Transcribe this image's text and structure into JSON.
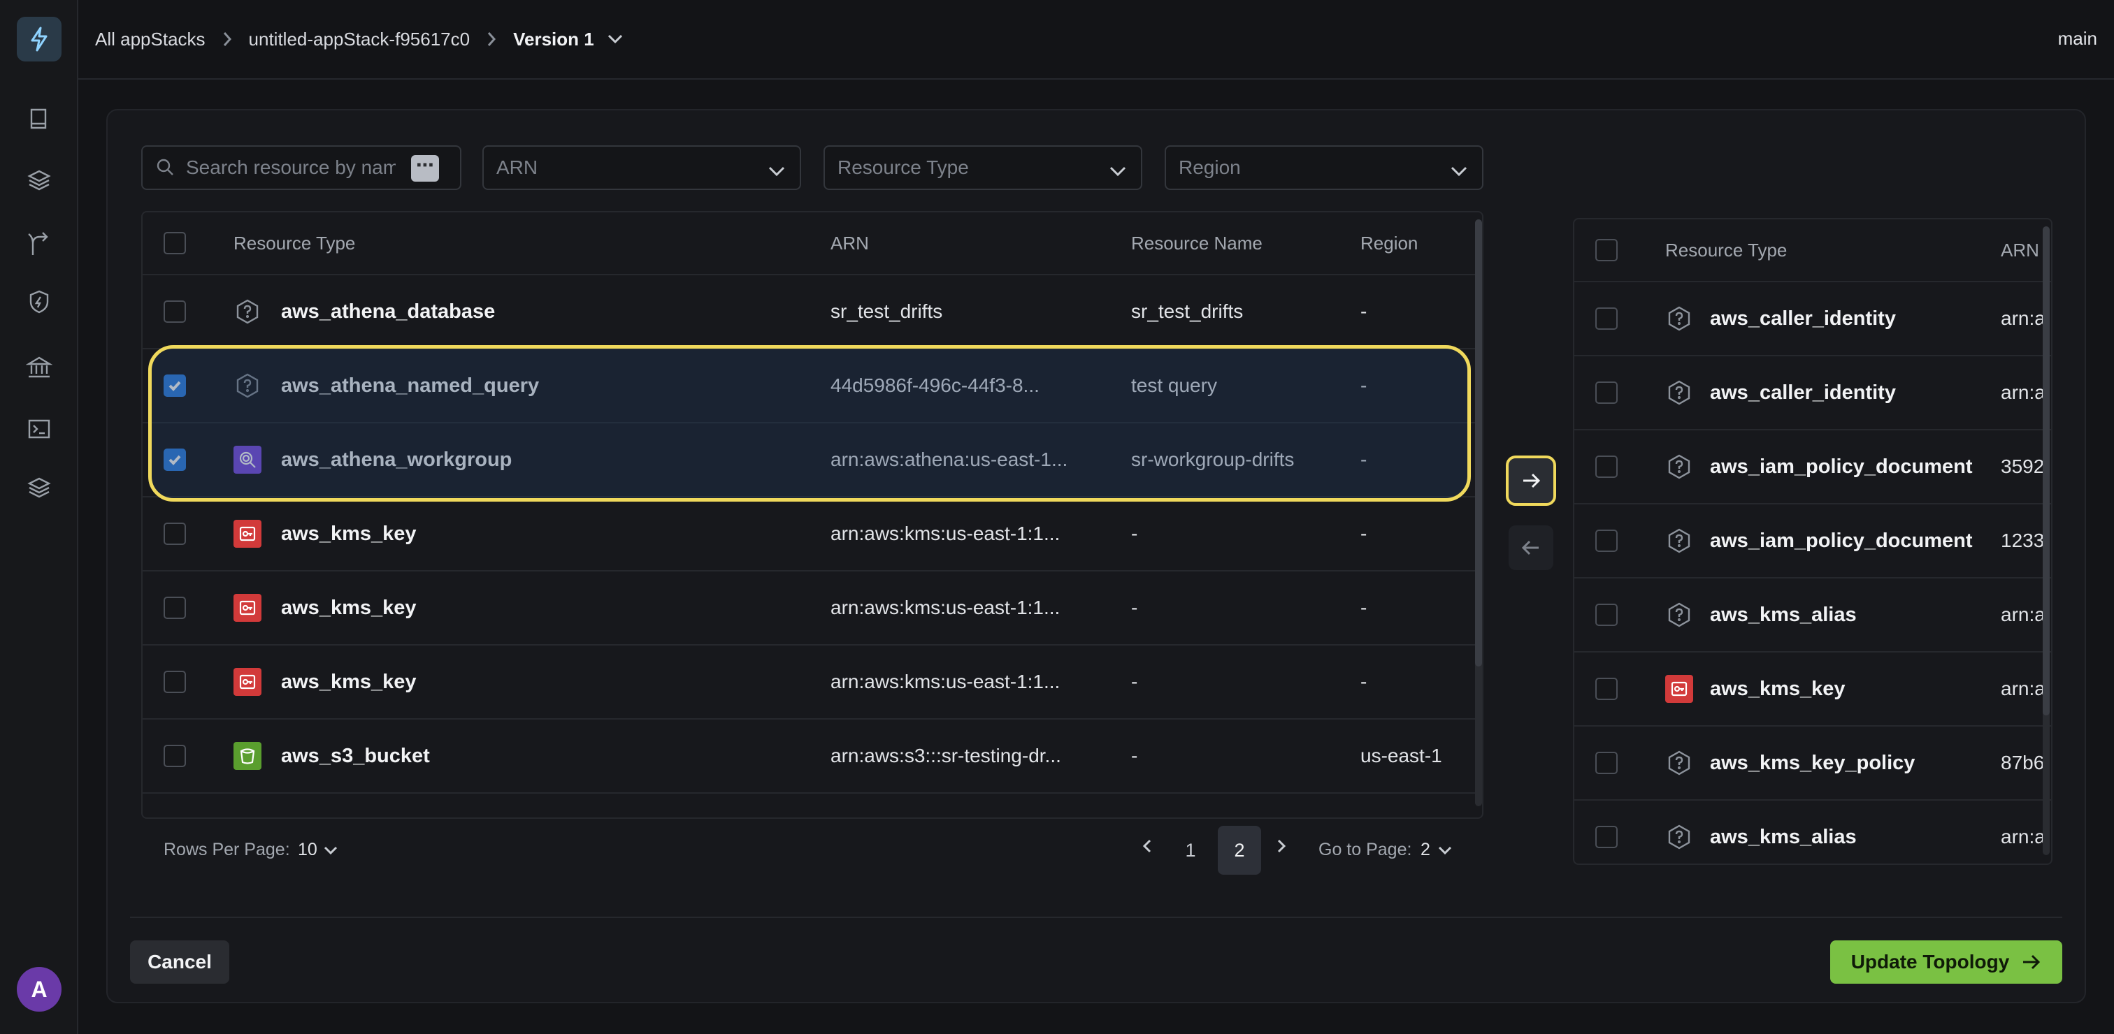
{
  "breadcrumb": {
    "root": "All appStacks",
    "stack": "untitled-appStack-f95617c0",
    "version": "Version 1"
  },
  "branch": "main",
  "avatar_letter": "A",
  "filters": {
    "search_placeholder": "Search resource by name",
    "arn": "ARN",
    "resource_type": "Resource Type",
    "region": "Region"
  },
  "left_table": {
    "headers": {
      "type": "Resource Type",
      "arn": "ARN",
      "name": "Resource Name",
      "region": "Region"
    },
    "rows": [
      {
        "type": "aws_athena_database",
        "arn": "sr_test_drifts",
        "name": "sr_test_drifts",
        "region": "-",
        "icon": "generic-resource-icon",
        "checked": false
      },
      {
        "type": "aws_athena_named_query",
        "arn": "44d5986f-496c-44f3-8...",
        "name": "test query",
        "region": "-",
        "icon": "generic-resource-icon",
        "checked": true
      },
      {
        "type": "aws_athena_workgroup",
        "arn": "arn:aws:athena:us-east-1...",
        "name": "sr-workgroup-drifts",
        "region": "-",
        "icon": "athena-icon",
        "checked": true
      },
      {
        "type": "aws_kms_key",
        "arn": "arn:aws:kms:us-east-1:1...",
        "name": "-",
        "region": "-",
        "icon": "kms-icon",
        "checked": false
      },
      {
        "type": "aws_kms_key",
        "arn": "arn:aws:kms:us-east-1:1...",
        "name": "-",
        "region": "-",
        "icon": "kms-icon",
        "checked": false
      },
      {
        "type": "aws_kms_key",
        "arn": "arn:aws:kms:us-east-1:1...",
        "name": "-",
        "region": "-",
        "icon": "kms-icon",
        "checked": false
      },
      {
        "type": "aws_s3_bucket",
        "arn": "arn:aws:s3:::sr-testing-dr...",
        "name": "-",
        "region": "us-east-1",
        "icon": "s3-icon",
        "checked": false
      }
    ]
  },
  "pagination": {
    "rows_per_page_label": "Rows Per Page:",
    "rows_per_page": "10",
    "pages": [
      "1",
      "2"
    ],
    "current_page": "2",
    "go_to_label": "Go to Page:",
    "go_to_value": "2"
  },
  "right_table": {
    "headers": {
      "type": "Resource Type",
      "arn": "ARN"
    },
    "rows": [
      {
        "type": "aws_caller_identity",
        "arn": "arn:a",
        "icon": "generic-resource-icon"
      },
      {
        "type": "aws_caller_identity",
        "arn": "arn:a",
        "icon": "generic-resource-icon"
      },
      {
        "type": "aws_iam_policy_document",
        "arn": "3592",
        "icon": "generic-resource-icon"
      },
      {
        "type": "aws_iam_policy_document",
        "arn": "1233",
        "icon": "generic-resource-icon"
      },
      {
        "type": "aws_kms_alias",
        "arn": "arn:a",
        "icon": "generic-resource-icon"
      },
      {
        "type": "aws_kms_key",
        "arn": "arn:a",
        "icon": "kms-icon"
      },
      {
        "type": "aws_kms_key_policy",
        "arn": "87b6",
        "icon": "generic-resource-icon"
      },
      {
        "type": "aws_kms_alias",
        "arn": "arn:a",
        "icon": "generic-resource-icon"
      }
    ]
  },
  "footer": {
    "cancel": "Cancel",
    "update": "Update Topology"
  },
  "colors": {
    "accent_green": "#7ac143",
    "highlight_yellow": "#f0d95c",
    "checkbox_blue": "#2f7fe0"
  }
}
